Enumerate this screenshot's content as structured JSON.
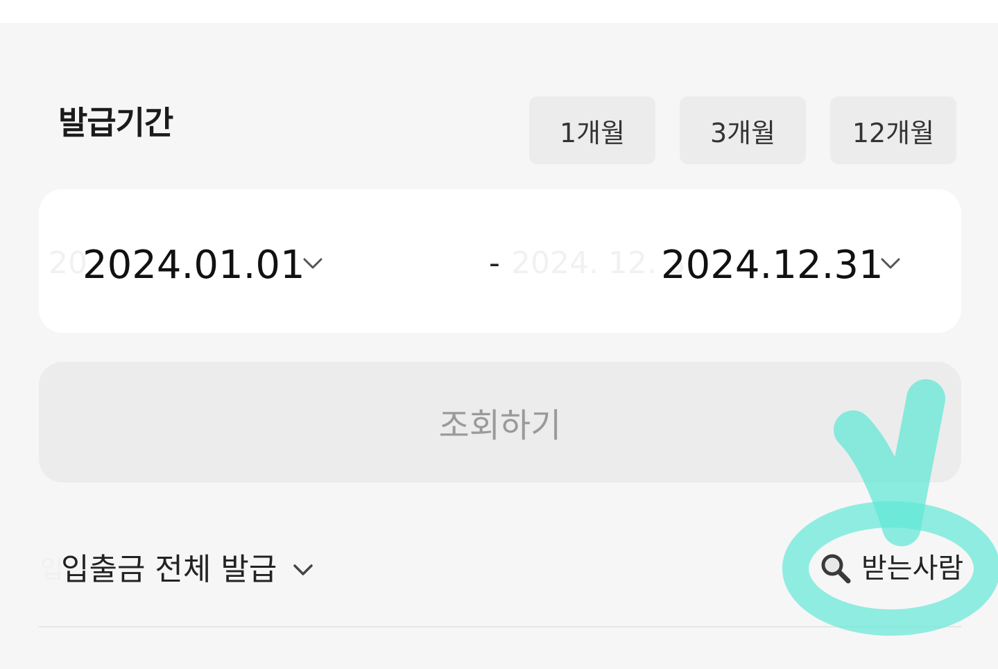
{
  "issue_period": {
    "title": "발급기간",
    "quick_buttons": [
      {
        "label": "1개월"
      },
      {
        "label": "3개월"
      },
      {
        "label": "12개월"
      }
    ]
  },
  "date_range": {
    "start_date": "2024.01.01",
    "start_ghost": "20",
    "separator": "-",
    "end_ghost": "2024. 12. 3",
    "end_date": "2024.12.31",
    "dropdown_icon": "chevron-down-icon"
  },
  "search": {
    "label": "조회하기"
  },
  "filter": {
    "selected": "입출금 전체 발급",
    "ghost": "입",
    "dropdown_icon": "chevron-down-icon"
  },
  "recipient": {
    "label": "받는사람",
    "icon": "magnifier-icon"
  },
  "colors": {
    "panel_bg": "#f6f6f6",
    "card_bg": "#ffffff",
    "button_bg": "#ececec",
    "disabled_text": "#9a9a9a",
    "annotation": "#5ee8d6"
  }
}
